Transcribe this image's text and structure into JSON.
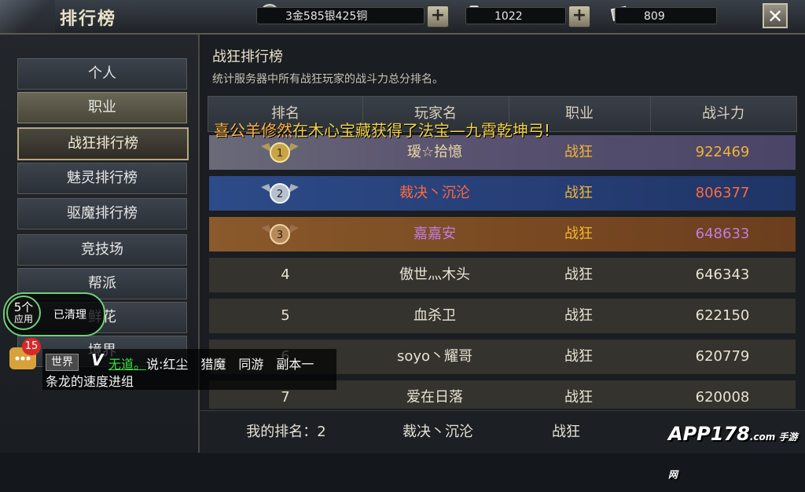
{
  "header": {
    "title": "排行榜",
    "currency": "3金585银425铜",
    "diamonds": "1022",
    "tickets": "809",
    "plus_label": "+",
    "close_label": "✕"
  },
  "nav": {
    "items": [
      {
        "label": "个人"
      },
      {
        "label": "职业"
      },
      {
        "label": "战狂排行榜"
      },
      {
        "label": "魅灵排行榜"
      },
      {
        "label": "驱魔排行榜"
      },
      {
        "label": "竞技场"
      },
      {
        "label": "帮派"
      },
      {
        "label": "鲜花"
      },
      {
        "label": "境界"
      }
    ]
  },
  "main": {
    "title": "战狂排行榜",
    "description": "统计服务器中所有战狂玩家的战斗力总分排名。",
    "columns": [
      "排名",
      "玩家名",
      "职业",
      "战斗力"
    ],
    "rows": [
      {
        "rank": "1",
        "name": "瑷☆拾憶",
        "class": "战狂",
        "power": "922469"
      },
      {
        "rank": "2",
        "name": "裁决丶沉沦",
        "class": "战狂",
        "power": "806377"
      },
      {
        "rank": "3",
        "name": "嘉嘉安",
        "class": "战狂",
        "power": "648633"
      },
      {
        "rank": "4",
        "name": "傲世灬木头",
        "class": "战狂",
        "power": "646343"
      },
      {
        "rank": "5",
        "name": "血杀卫",
        "class": "战狂",
        "power": "622150"
      },
      {
        "rank": "6",
        "name": "soyo丶耀哥",
        "class": "战狂",
        "power": "620779"
      },
      {
        "rank": "7",
        "name": "爱在日落",
        "class": "战狂",
        "power": "620008"
      }
    ],
    "my_rank_label": "我的排名：2",
    "my_name": "裁决丶沉沦",
    "my_class": "战狂"
  },
  "broadcast": {
    "player": "喜公羊修然",
    "text": "在木心宝藏获得了法宝—九霄乾坤弓!"
  },
  "overlay": {
    "apps_count": "5个",
    "apps_label": "应用",
    "cleaned_label": "已清理",
    "chat_badge": "15",
    "channel": "世界",
    "vip": "V",
    "sender": "无道。",
    "message_line1": "说:红尘　猎魔　同游　副本一",
    "message_line2": "条龙的速度进组"
  },
  "watermark": {
    "text": "APP178",
    "sub": ".com 手游网"
  },
  "colors": {
    "gold_text": "#f1d24a",
    "rank1_row": "#5a5370",
    "rank2_row": "#283f78",
    "rank3_row": "#7a4a22",
    "name_rank1": "#e8d7a0",
    "name_rank2": "#ff6a3a",
    "name_rank3": "#c27be0",
    "class_top3": "#f2b430"
  }
}
